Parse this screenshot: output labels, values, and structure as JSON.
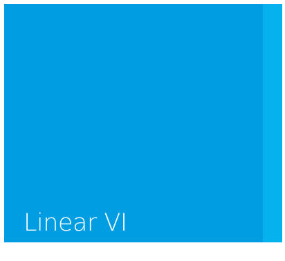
{
  "tile": {
    "label": "Linear VI",
    "background_color": "#019de3",
    "text_color": "#ffffff"
  },
  "side_strip": {
    "background_color": "#05b2ee"
  }
}
